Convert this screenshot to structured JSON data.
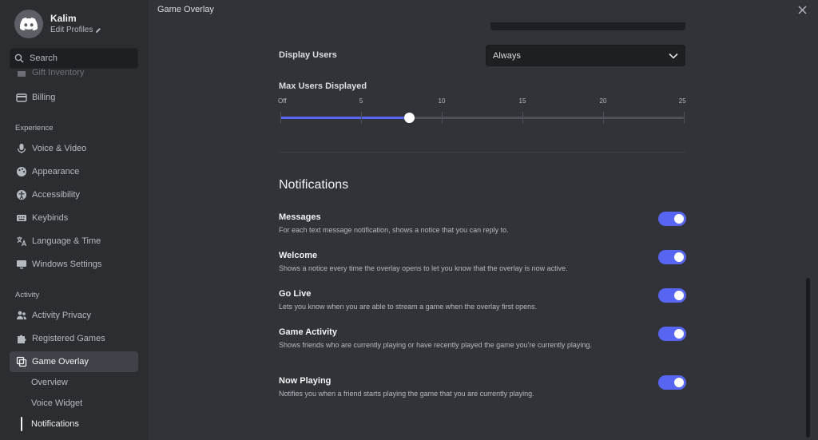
{
  "profile": {
    "name": "Kalim",
    "edit_label": "Edit Profiles"
  },
  "search": {
    "placeholder": "Search"
  },
  "sidebar": {
    "items_top": [
      {
        "label": "Gift Inventory",
        "icon": "gift-icon"
      },
      {
        "label": "Billing",
        "icon": "card-icon"
      }
    ],
    "experience_header": "Experience",
    "experience_items": [
      {
        "label": "Voice & Video",
        "icon": "mic-icon"
      },
      {
        "label": "Appearance",
        "icon": "palette-icon"
      },
      {
        "label": "Accessibility",
        "icon": "accessibility-icon"
      },
      {
        "label": "Keybinds",
        "icon": "keyboard-icon"
      },
      {
        "label": "Language & Time",
        "icon": "language-icon"
      },
      {
        "label": "Windows Settings",
        "icon": "monitor-icon"
      }
    ],
    "activity_header": "Activity",
    "activity_items": [
      {
        "label": "Activity Privacy",
        "icon": "people-icon"
      },
      {
        "label": "Registered Games",
        "icon": "puzzle-icon"
      },
      {
        "label": "Game Overlay",
        "icon": "overlay-icon"
      }
    ],
    "sub_items": [
      "Overview",
      "Voice Widget",
      "Notifications"
    ]
  },
  "main": {
    "title": "Game Overlay",
    "display_users": {
      "label": "Display Users",
      "value": "Always"
    },
    "max_users": {
      "label": "Max Users Displayed",
      "ticks": [
        "Off",
        "5",
        "10",
        "15",
        "20",
        "25"
      ],
      "value": 8,
      "max": 25
    },
    "notifications_heading": "Notifications",
    "notifications": [
      {
        "title": "Messages",
        "desc": "For each text message notification, shows a notice that you can reply to.",
        "enabled": true
      },
      {
        "title": "Welcome",
        "desc": "Shows a notice every time the overlay opens to let you know that the overlay is now active.",
        "enabled": true
      },
      {
        "title": "Go Live",
        "desc": "Lets you know when you are able to stream a game when the overlay first opens.",
        "enabled": true
      },
      {
        "title": "Game Activity",
        "desc": "Shows friends who are currently playing or have recently played the game you're currently playing.",
        "enabled": true
      },
      {
        "title": "Now Playing",
        "desc": "Notifies you when a friend starts playing the game that you are currently playing.",
        "enabled": true
      }
    ]
  },
  "colors": {
    "accent": "#5865f2",
    "sidebar_bg": "#2b2d31",
    "main_bg": "#313338"
  }
}
